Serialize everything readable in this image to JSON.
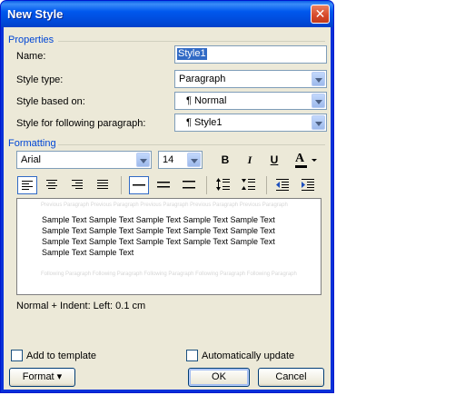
{
  "window": {
    "title": "New Style",
    "close_label": "✕"
  },
  "properties": {
    "group_label": "Properties",
    "name_label": "Name:",
    "name_value": "Style1",
    "style_type_label": "Style type:",
    "style_type_value": "Paragraph",
    "based_on_label": "Style based on:",
    "based_on_value": "¶ Normal",
    "following_label": "Style for following paragraph:",
    "following_value": "¶ Style1"
  },
  "formatting": {
    "group_label": "Formatting",
    "font_value": "Arial",
    "size_value": "14",
    "bold_label": "B",
    "italic_label": "I",
    "underline_label": "U",
    "font_color_label": "A"
  },
  "preview": {
    "prev_ghost": "Previous Paragraph Previous Paragraph Previous Paragraph Previous Paragraph Previous Paragraph",
    "sample_text": "Sample Text Sample Text Sample Text Sample Text Sample Text Sample Text Sample Text Sample Text Sample Text Sample Text Sample Text Sample Text Sample Text Sample Text Sample Text Sample Text Sample Text",
    "next_ghost": "Following Paragraph Following Paragraph Following Paragraph Following Paragraph Following Paragraph"
  },
  "description": "Normal + Indent: Left:  0.1 cm",
  "add_to_template": {
    "label": "Add to template",
    "checked": false
  },
  "auto_update": {
    "label": "Automatically update",
    "checked": false
  },
  "buttons": {
    "format": "Format ▾",
    "ok": "OK",
    "cancel": "Cancel"
  }
}
